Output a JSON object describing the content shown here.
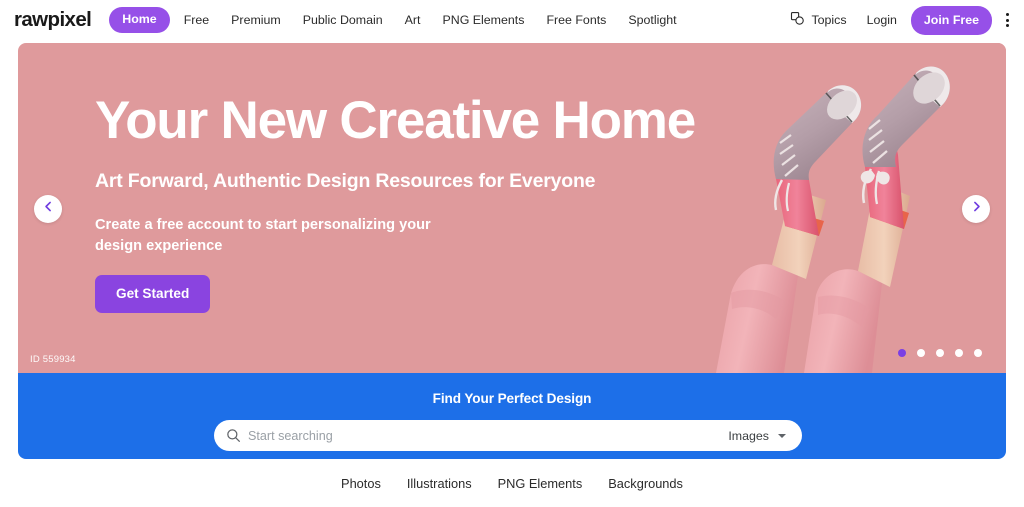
{
  "nav": {
    "logo": "rawpixel",
    "links": [
      {
        "label": "Home",
        "active": true
      },
      {
        "label": "Free",
        "active": false
      },
      {
        "label": "Premium",
        "active": false
      },
      {
        "label": "Public Domain",
        "active": false
      },
      {
        "label": "Art",
        "active": false
      },
      {
        "label": "PNG Elements",
        "active": false
      },
      {
        "label": "Free Fonts",
        "active": false
      },
      {
        "label": "Spotlight",
        "active": false
      }
    ],
    "topics_label": "Topics",
    "topics_icon": "shapes-icon",
    "login_label": "Login",
    "join_label": "Join Free",
    "menu_icon": "kebab-menu-icon"
  },
  "hero": {
    "title": "Your New Creative Home",
    "subtitle": "Art Forward, Authentic Design Resources for Everyone",
    "body": "Create a free account to start personalizing your design experience",
    "cta_label": "Get Started",
    "id_tag": "ID 559934",
    "prev_icon": "chevron-left-icon",
    "next_icon": "chevron-right-icon",
    "slides": 5,
    "active_slide": 1,
    "background_color": "#df9a9c",
    "image_alt": "legs-up-pink-sneakers-photo"
  },
  "search": {
    "band_title": "Find Your Perfect Design",
    "placeholder": "Start searching",
    "value": "",
    "type_label": "Images",
    "search_icon": "search-icon",
    "caret_icon": "chevron-down-icon",
    "band_color": "#1d6fe8"
  },
  "categories": [
    {
      "label": "Photos"
    },
    {
      "label": "Illustrations"
    },
    {
      "label": "PNG Elements"
    },
    {
      "label": "Backgrounds"
    }
  ],
  "colors": {
    "brand_purple": "#9650e8",
    "cta_purple": "#8a44e0",
    "band_blue": "#1d6fe8",
    "hero_pink": "#df9a9c"
  }
}
